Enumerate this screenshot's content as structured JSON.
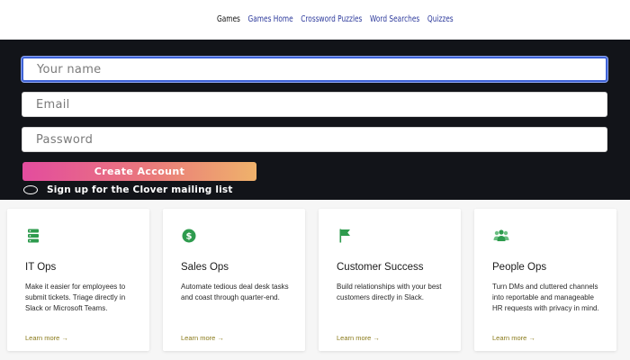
{
  "nav": {
    "links": [
      "Games",
      "Games Home",
      "Crossword Puzzles",
      "Word Searches",
      "Quizzes"
    ]
  },
  "signup": {
    "name_placeholder": "Your name",
    "email_placeholder": "Email",
    "password_placeholder": "Password",
    "create_button": "Create Account",
    "mailing_label": "Sign up for the Clover mailing list"
  },
  "cards": [
    {
      "icon": "server-icon",
      "title": "IT Ops",
      "desc": "Make it easier for employees to submit tickets. Triage directly in Slack or Microsoft Teams.",
      "more": "Learn more →"
    },
    {
      "icon": "dollar-coin-icon",
      "title": "Sales Ops",
      "desc": "Automate tedious deal desk tasks and coast through quarter-end.",
      "more": "Learn more →"
    },
    {
      "icon": "flag-icon",
      "title": "Customer Success",
      "desc": "Build relationships with your best customers directly in Slack.",
      "more": "Learn more →"
    },
    {
      "icon": "people-icon",
      "title": "People Ops",
      "desc": "Turn DMs and cluttered channels into reportable and manageable HR requests with privacy in mind.",
      "more": "Learn more →"
    }
  ],
  "colors": {
    "accent_green": "#2e9b4e",
    "link_blue": "#2d3a9c",
    "dark_bg": "#121419",
    "focus_blue": "#3f63d6"
  }
}
